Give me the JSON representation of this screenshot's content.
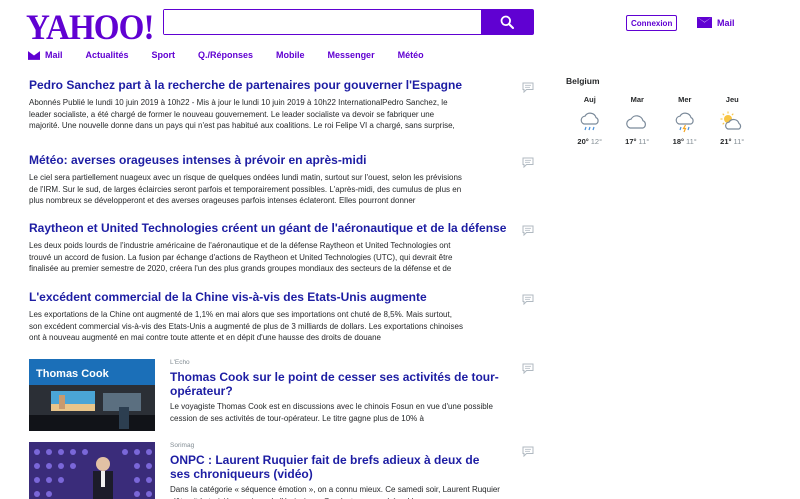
{
  "header": {
    "logo": "YAHOO!",
    "search_value": "",
    "login_label": "Connexion",
    "mail_label": "Mail"
  },
  "nav": [
    {
      "label": "Mail"
    },
    {
      "label": "Actualités"
    },
    {
      "label": "Sport"
    },
    {
      "label": "Q./Réponses"
    },
    {
      "label": "Mobile"
    },
    {
      "label": "Messenger"
    },
    {
      "label": "Météo"
    }
  ],
  "stories": [
    {
      "title": "Pedro Sanchez part à la recherche de partenaires pour gouverner l'Espagne",
      "summary": "Abonnés Publié le lundi 10 juin 2019 à 10h22 - Mis à jour le lundi 10 juin 2019 à 10h22 InternationalPedro Sanchez, le leader socialiste, a été chargé de former le nouveau gouvernement. Le leader socialiste va devoir se fabriquer une majorité. Une nouvelle donne dans un pays qui n'est pas habitué aux coalitions. Le roi Felipe VI a chargé, sans surprise,"
    },
    {
      "title": "Météo: averses orageuses intenses à prévoir en après-midi",
      "summary": "Le ciel sera partiellement nuageux avec un risque de quelques ondées lundi matin, surtout sur l'ouest, selon les prévisions de l'IRM. Sur le sud, de larges éclaircies seront parfois et temporairement possibles. L'après-midi, des cumulus de plus en plus nombreux se développeront et des averses orageuses parfois intenses éclateront. Elles pourront donner"
    },
    {
      "title": "Raytheon et United Technologies créent un géant de l'aéronautique et de la défense",
      "summary": "Les deux poids lourds de l'industrie américaine de l'aéronautique et de la défense Raytheon et United Technologies ont trouvé un accord de fusion. La fusion par échange d'actions de Raytheon et United Technologies (UTC), qui devrait être finalisée au premier semestre de 2020, créera l'un des plus grands groupes mondiaux des secteurs de la défense et de"
    },
    {
      "title": "L'excédent commercial de la Chine vis-à-vis des Etats-Unis augmente",
      "summary": "Les exportations de la Chine ont augmenté de 1,1% en mai alors que ses importations ont chuté de 8,5%. Mais surtout, son excédent commercial vis-à-vis des Etats-Unis a augmenté de plus de 3 milliards de dollars. Les exportations chinoises ont à nouveau augmenté en mai contre toute attente et en dépit d'une hausse des droits de douane"
    }
  ],
  "thumb_stories": [
    {
      "source": "L'Echo",
      "thumb_text": "Thomas Cook",
      "title": "Thomas Cook sur le point de cesser ses activités de tour-opérateur?",
      "summary": "Le voyagiste Thomas Cook est en discussions avec le chinois Fosun en vue d'une possible cession de ses activités de tour-opérateur. Le titre gagne plus de 10% à"
    },
    {
      "source": "Sorimag",
      "title": "ONPC : Laurent Ruquier fait de brefs adieux à deux de ses chroniqueurs (vidéo)",
      "summary": "Dans la catégorie « séquence émotion », on a connu mieux. Ce samedi soir, Laurent Ruquier clôturait la treizième saison de l'émission « On n'est pas couché ». L'an"
    }
  ],
  "weather": {
    "location": "Belgium",
    "days": [
      {
        "name": "Auj",
        "icon": "rain-cloud-icon",
        "high": "20°",
        "low": "12°"
      },
      {
        "name": "Mar",
        "icon": "cloud-icon",
        "high": "17°",
        "low": "11°"
      },
      {
        "name": "Mer",
        "icon": "thunderstorm-icon",
        "high": "18°",
        "low": "11°"
      },
      {
        "name": "Jeu",
        "icon": "partly-sunny-icon",
        "high": "21°",
        "low": "11°"
      }
    ]
  },
  "colors": {
    "brand": "#6001d2",
    "headline": "#1d1da3",
    "text": "#26282a",
    "muted": "#828c93"
  }
}
